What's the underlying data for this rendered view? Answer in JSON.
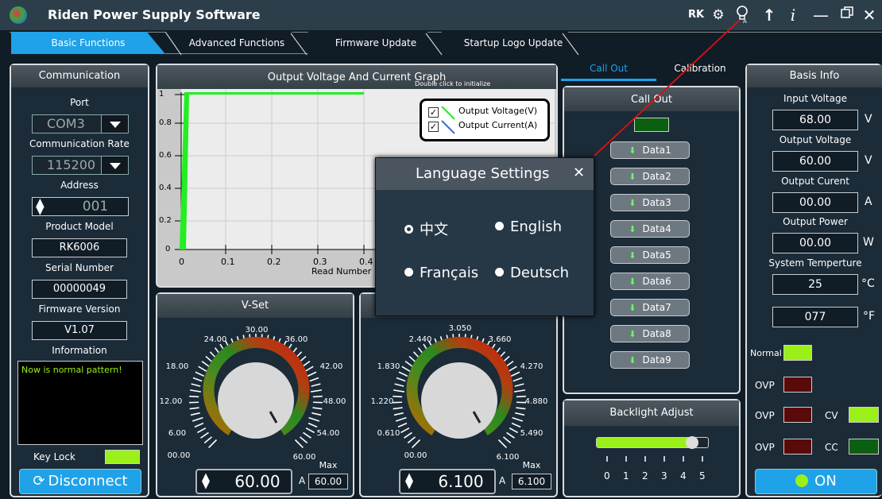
{
  "app": {
    "title": "Riden Power Supply Software",
    "rk_label": "RK"
  },
  "tabs": [
    "Basic Functions",
    "Advanced Functions",
    "Firmware Update",
    "Startup Logo Update"
  ],
  "communication": {
    "title": "Communication",
    "port_label": "Port",
    "port_value": "COM3",
    "rate_label": "Communication Rate",
    "rate_value": "115200",
    "address_label": "Address",
    "address_value": "001",
    "model_label": "Product Model",
    "model_value": "RK6006",
    "serial_label": "Serial Number",
    "serial_value": "00000049",
    "firmware_label": "Firmware Version",
    "firmware_value": "V1.07",
    "info_label": "Information",
    "info_text": "Now is normal pattern!",
    "keylock_label": "Key Lock",
    "disconnect_label": "Disconnect"
  },
  "graph": {
    "title": "Output Voltage And Current Graph",
    "hint": "Double click to initialize",
    "legend_voltage": "Output Voltage(V)",
    "legend_current": "Output Current(A)",
    "xlabel": "Read Number",
    "y_ticks": [
      "1",
      "0.8",
      "0.6",
      "0.4",
      "0.2",
      "0"
    ],
    "x_ticks": [
      "0",
      "0.1",
      "0.2",
      "0.3",
      "0.4"
    ]
  },
  "vset": {
    "title": "V-Set",
    "ticks": [
      "00.00",
      "6.00",
      "12.00",
      "18.00",
      "24.00",
      "30.00",
      "36.00",
      "42.00",
      "48.00",
      "54.00",
      "60.00"
    ],
    "value": "60.00",
    "unit": "A",
    "max_label": "Max",
    "max_value": "60.00"
  },
  "iset": {
    "ticks": [
      "00.00",
      "0.610",
      "1.220",
      "1.830",
      "2.440",
      "3.050",
      "3.660",
      "4.270",
      "4.880",
      "5.490",
      "6.100"
    ],
    "value": "6.100",
    "unit": "A",
    "max_label": "Max",
    "max_value": "6.100"
  },
  "callout_tabs": {
    "callout": "Call Out",
    "calibration": "Calibration"
  },
  "callout": {
    "title": "Call Out",
    "buttons": [
      "Data1",
      "Data2",
      "Data3",
      "Data4",
      "Data5",
      "Data6",
      "Data7",
      "Data8",
      "Data9"
    ]
  },
  "backlight": {
    "title": "Backlight Adjust",
    "ticks": [
      "0",
      "1",
      "2",
      "3",
      "4",
      "5"
    ],
    "level_fraction": 0.86
  },
  "basis": {
    "title": "Basis Info",
    "input_voltage_label": "Input Voltage",
    "input_voltage": "68.00",
    "input_voltage_unit": "V",
    "output_voltage_label": "Output Voltage",
    "output_voltage": "60.00",
    "output_voltage_unit": "V",
    "output_current_label": "Output Curent",
    "output_current": "00.00",
    "output_current_unit": "A",
    "output_power_label": "Output Power",
    "output_power": "00.00",
    "output_power_unit": "W",
    "temp_label": "System Temperture",
    "temp_c": "25",
    "temp_c_unit": "°C",
    "temp_f": "077",
    "temp_f_unit": "°F",
    "normal_label": "Normal",
    "ovp1_label": "OVP",
    "ovp2_label": "OVP",
    "ovp3_label": "OVP",
    "cv_label": "CV",
    "cc_label": "CC",
    "on_label": "ON"
  },
  "language_dialog": {
    "title": "Language Settings",
    "options": [
      "中文",
      "English",
      "Français",
      "Deutsch"
    ],
    "selected": "中文"
  },
  "colors": {
    "accent": "#1fa2e8",
    "led_green": "#9bf01a",
    "led_red": "#5a0a0a",
    "curve_green": "#22ee22",
    "curve_blue": "#3a6edc"
  }
}
